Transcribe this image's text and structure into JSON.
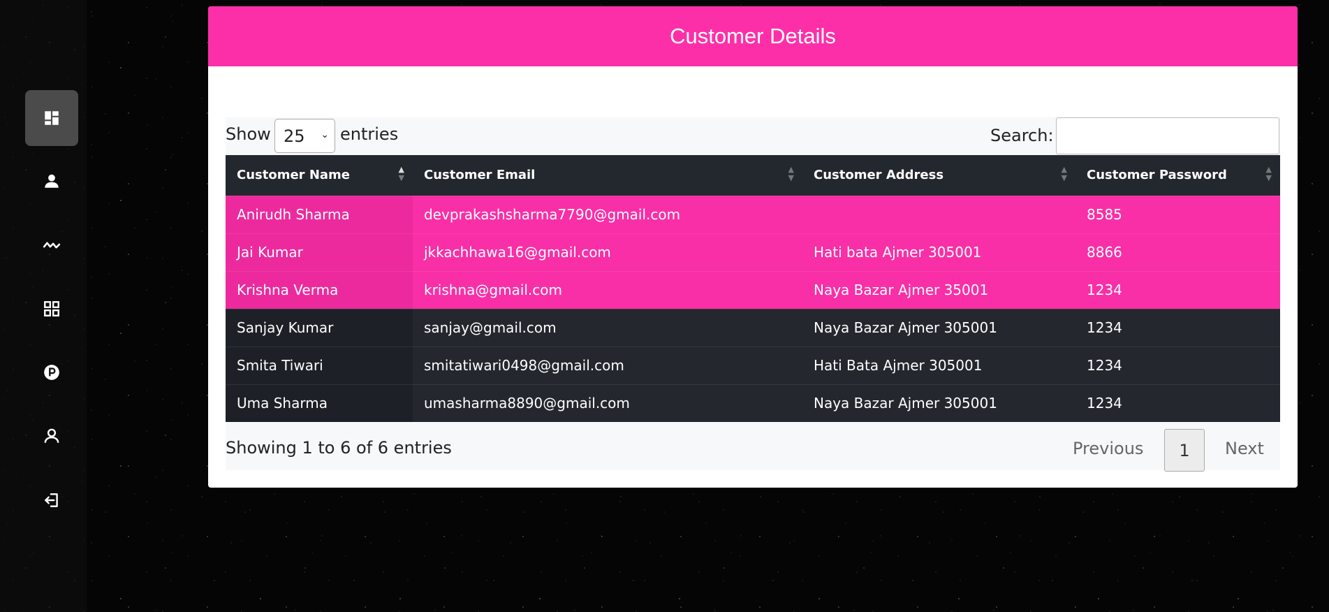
{
  "sidebar": {
    "items": [
      {
        "icon": "dashboard-icon",
        "active": true
      },
      {
        "icon": "user-filled-icon"
      },
      {
        "icon": "activity-icon"
      },
      {
        "icon": "grid-icon"
      },
      {
        "icon": "parking-icon"
      },
      {
        "icon": "user-outline-icon"
      },
      {
        "icon": "logout-icon"
      }
    ]
  },
  "header": {
    "title": "Customer Details"
  },
  "controls": {
    "show_label": "Show",
    "length_value": "25",
    "entries_label": "entries",
    "search_label": "Search:",
    "search_value": ""
  },
  "table": {
    "headers": [
      "Customer Name",
      "Customer Email",
      "Customer Address",
      "Customer Password"
    ],
    "rows": [
      [
        "Anirudh Sharma",
        "devprakashsharma7790@gmail.com",
        "",
        "8585"
      ],
      [
        "Jai Kumar",
        "jkkachhawa16@gmail.com",
        "Hati bata Ajmer 305001",
        "8866"
      ],
      [
        "Krishna Verma",
        "krishna@gmail.com",
        "Naya Bazar Ajmer 35001",
        "1234"
      ],
      [
        "Sanjay Kumar",
        "sanjay@gmail.com",
        "Naya Bazar Ajmer 305001",
        "1234"
      ],
      [
        "Smita Tiwari",
        "smitatiwari0498@gmail.com",
        "Hati Bata Ajmer 305001",
        "1234"
      ],
      [
        "Uma Sharma",
        "umasharma8890@gmail.com",
        "Naya Bazar Ajmer 305001",
        "1234"
      ]
    ]
  },
  "footer": {
    "info": "Showing 1 to 6 of 6 entries",
    "previous": "Previous",
    "page": "1",
    "next": "Next"
  },
  "colors": {
    "accent": "#fd2fa8",
    "dark_row": "#24272e",
    "header_row": "#23272e"
  }
}
